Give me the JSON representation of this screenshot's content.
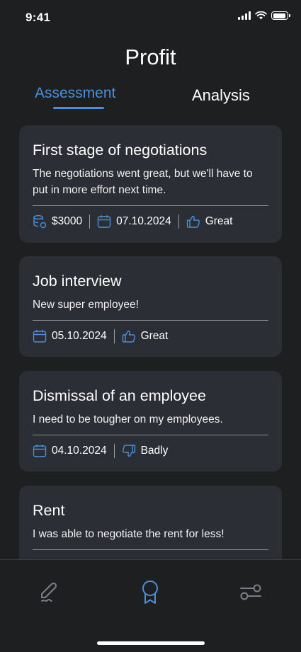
{
  "status": {
    "time": "9:41"
  },
  "header": {
    "title": "Profit"
  },
  "tabs": [
    {
      "label": "Assessment",
      "active": true
    },
    {
      "label": "Analysis",
      "active": false
    }
  ],
  "cards": [
    {
      "title": "First stage of negotiations",
      "description": "The negotiations went great, but we'll have to put in more effort next time.",
      "amount": "$3000",
      "date": "07.10.2024",
      "rating": "Great",
      "rating_icon": "thumbs-up-icon"
    },
    {
      "title": "Job interview",
      "description": "New super employee!",
      "date": "05.10.2024",
      "rating": "Great",
      "rating_icon": "thumbs-up-icon"
    },
    {
      "title": "Dismissal of an employee",
      "description": "I need to be tougher on my employees.",
      "date": "04.10.2024",
      "rating": "Badly",
      "rating_icon": "thumbs-down-icon"
    },
    {
      "title": "Rent",
      "description": "I was able to negotiate the rent for less!"
    }
  ],
  "nav": [
    {
      "name": "pen-icon",
      "active": false
    },
    {
      "name": "award-icon",
      "active": true
    },
    {
      "name": "sliders-icon",
      "active": false
    }
  ],
  "colors": {
    "accent": "#4a8fd9",
    "background": "#1e1f21",
    "card": "#2b2e34"
  }
}
